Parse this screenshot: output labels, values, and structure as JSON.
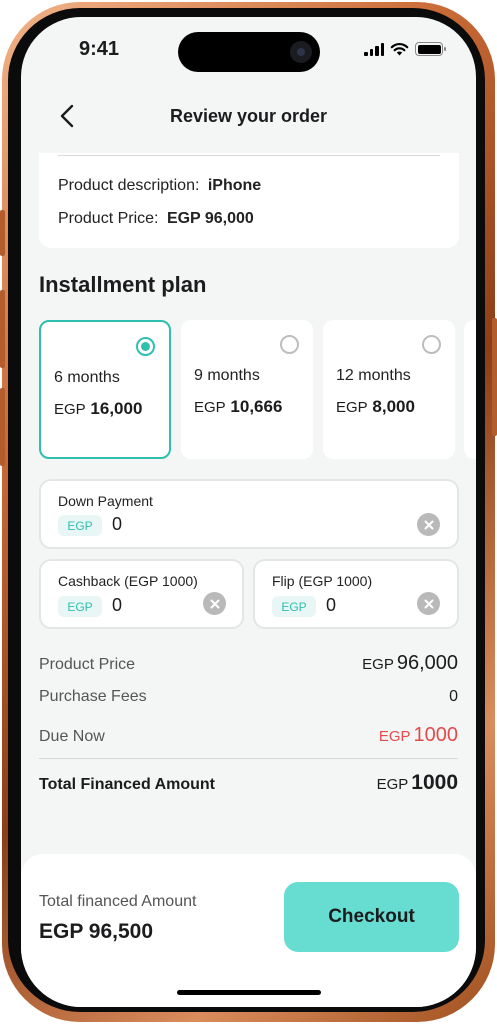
{
  "status_bar": {
    "time": "9:41"
  },
  "header": {
    "title": "Review your order"
  },
  "product": {
    "description_label": "Product description:",
    "description_value": "iPhone",
    "price_label": "Product Price:",
    "price_value": "EGP 96,000"
  },
  "installment": {
    "title": "Installment plan",
    "plans": [
      {
        "term": "6 months",
        "currency": "EGP",
        "amount": "16,000",
        "selected": true
      },
      {
        "term": "9 months",
        "currency": "EGP",
        "amount": "10,666",
        "selected": false
      },
      {
        "term": "12 months",
        "currency": "EGP",
        "amount": "8,000",
        "selected": false
      }
    ]
  },
  "fields": {
    "down_payment": {
      "label": "Down Payment",
      "currency": "EGP",
      "value": "0"
    },
    "cashback": {
      "label": "Cashback (EGP 1000)",
      "currency": "EGP",
      "value": "0"
    },
    "flip": {
      "label": "Flip (EGP 1000)",
      "currency": "EGP",
      "value": "0"
    }
  },
  "summary": {
    "product_price_label": "Product Price",
    "product_price_currency": "EGP",
    "product_price_value": "96,000",
    "purchase_fees_label": "Purchase Fees",
    "purchase_fees_value": "0",
    "due_now_label": "Due Now",
    "due_now_currency": "EGP",
    "due_now_value": "1000",
    "total_label": "Total Financed Amount",
    "total_currency": "EGP",
    "total_value": "1000"
  },
  "footer": {
    "label": "Total financed Amount",
    "amount": "EGP 96,500",
    "checkout_label": "Checkout"
  },
  "colors": {
    "accent": "#2fbfae",
    "checkout_bg": "#66ddd0",
    "due_red": "#e14b4b",
    "frame": "#c96a36"
  },
  "icons": {
    "back": "chevron-left-icon",
    "clear": "close-circle-icon",
    "radio": "radio-icon"
  }
}
